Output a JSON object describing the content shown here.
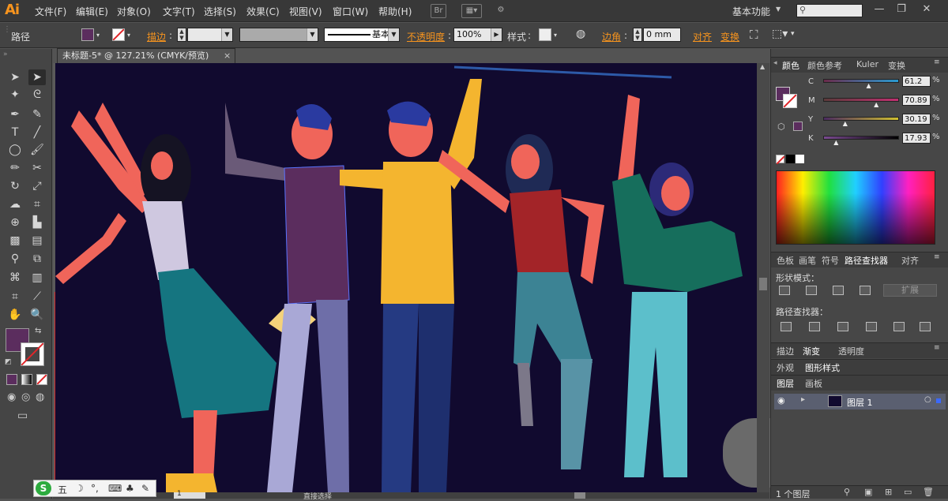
{
  "app": {
    "logo": "Ai"
  },
  "menu": [
    "文件(F)",
    "编辑(E)",
    "对象(O)",
    "文字(T)",
    "选择(S)",
    "效果(C)",
    "视图(V)",
    "窗口(W)",
    "帮助(H)"
  ],
  "menubar_icons": {
    "br": "Br"
  },
  "workspace": "基本功能",
  "window_buttons": {
    "minimize": "—",
    "restore": "❐",
    "close": "✕"
  },
  "control": {
    "object_type": "路径",
    "stroke_label": "描边",
    "stroke_profile": "基本",
    "opacity_label": "不透明度",
    "opacity_value": "100%",
    "style_label": "样式",
    "corner_label": "边角",
    "corner_value": "0 mm",
    "align_label": "对齐",
    "transform_label": "变换"
  },
  "document_tab": {
    "title": "未标题-5* @ 127.21% (CMYK/预览)",
    "close": "×"
  },
  "colors": {
    "fill": "#5b2d5e",
    "artboard": "#110a2f",
    "accent": "#f7941e"
  },
  "panels": {
    "color_tabs": [
      "颜色",
      "颜色参考",
      "Kuler",
      "变换"
    ],
    "cmyk": [
      {
        "channel": "C",
        "value": "61.2",
        "pct": 0.61
      },
      {
        "channel": "M",
        "value": "70.89",
        "pct": 0.71
      },
      {
        "channel": "Y",
        "value": "30.19",
        "pct": 0.3
      },
      {
        "channel": "K",
        "value": "17.93",
        "pct": 0.18
      }
    ],
    "pct_sign": "%",
    "pathfinder_tabs": [
      "色板",
      "画笔",
      "符号",
      "路径查找器",
      "对齐"
    ],
    "shape_modes_label": "形状模式：",
    "expand_button": "扩展",
    "pathfinders_label": "路径查找器：",
    "stroke_tabs": [
      "描边",
      "渐变",
      "透明度"
    ],
    "appearance_tabs": [
      "外观",
      "图形样式"
    ],
    "layers_tabs": [
      "图层",
      "画板"
    ],
    "layer_name": "图层 1",
    "layer_count": "1 个图层"
  },
  "status": {
    "zoom": "1",
    "tool": "直接选择"
  },
  "ime": {
    "label": "五"
  }
}
